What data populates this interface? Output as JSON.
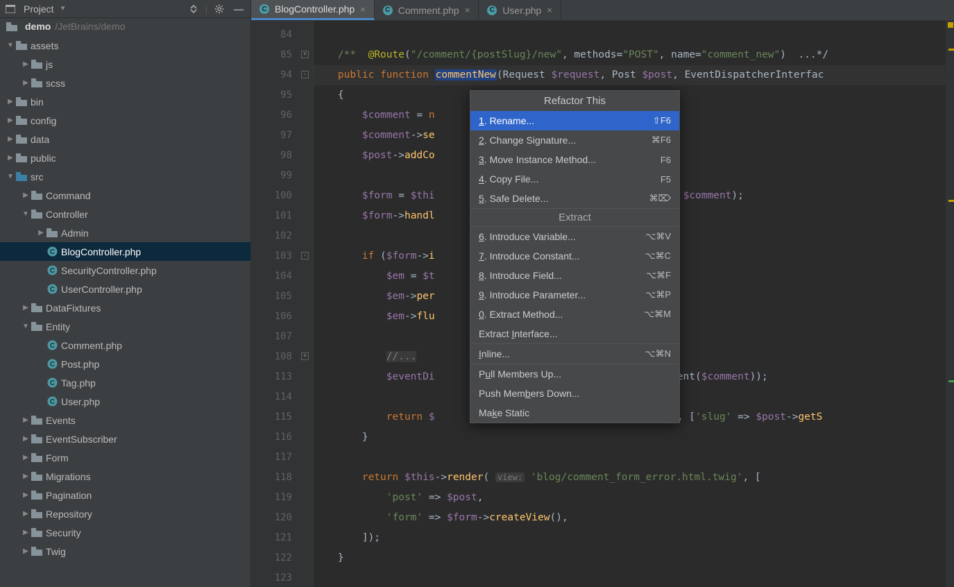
{
  "project_panel": {
    "title": "Project",
    "root_name": "demo",
    "root_path": "/JetBrains/demo",
    "tree": [
      {
        "depth": 0,
        "arrow": "exp",
        "kind": "folder",
        "label": "assets"
      },
      {
        "depth": 1,
        "arrow": "col",
        "kind": "folder",
        "label": "js"
      },
      {
        "depth": 1,
        "arrow": "col",
        "kind": "folder",
        "label": "scss"
      },
      {
        "depth": 0,
        "arrow": "col",
        "kind": "folder",
        "label": "bin"
      },
      {
        "depth": 0,
        "arrow": "col",
        "kind": "folder",
        "label": "config"
      },
      {
        "depth": 0,
        "arrow": "col",
        "kind": "folder",
        "label": "data"
      },
      {
        "depth": 0,
        "arrow": "col",
        "kind": "folder",
        "label": "public"
      },
      {
        "depth": 0,
        "arrow": "exp",
        "kind": "folder-src",
        "label": "src"
      },
      {
        "depth": 1,
        "arrow": "col",
        "kind": "folder",
        "label": "Command"
      },
      {
        "depth": 1,
        "arrow": "exp",
        "kind": "folder",
        "label": "Controller"
      },
      {
        "depth": 2,
        "arrow": "col",
        "kind": "folder",
        "label": "Admin"
      },
      {
        "depth": 2,
        "arrow": "none",
        "kind": "php",
        "label": "BlogController.php",
        "selected": true
      },
      {
        "depth": 2,
        "arrow": "none",
        "kind": "php",
        "label": "SecurityController.php"
      },
      {
        "depth": 2,
        "arrow": "none",
        "kind": "php",
        "label": "UserController.php"
      },
      {
        "depth": 1,
        "arrow": "col",
        "kind": "folder",
        "label": "DataFixtures"
      },
      {
        "depth": 1,
        "arrow": "exp",
        "kind": "folder",
        "label": "Entity"
      },
      {
        "depth": 2,
        "arrow": "none",
        "kind": "php",
        "label": "Comment.php"
      },
      {
        "depth": 2,
        "arrow": "none",
        "kind": "php",
        "label": "Post.php"
      },
      {
        "depth": 2,
        "arrow": "none",
        "kind": "php",
        "label": "Tag.php"
      },
      {
        "depth": 2,
        "arrow": "none",
        "kind": "php",
        "label": "User.php"
      },
      {
        "depth": 1,
        "arrow": "col",
        "kind": "folder",
        "label": "Events"
      },
      {
        "depth": 1,
        "arrow": "col",
        "kind": "folder",
        "label": "EventSubscriber"
      },
      {
        "depth": 1,
        "arrow": "col",
        "kind": "folder",
        "label": "Form"
      },
      {
        "depth": 1,
        "arrow": "col",
        "kind": "folder",
        "label": "Migrations"
      },
      {
        "depth": 1,
        "arrow": "col",
        "kind": "folder",
        "label": "Pagination"
      },
      {
        "depth": 1,
        "arrow": "col",
        "kind": "folder",
        "label": "Repository"
      },
      {
        "depth": 1,
        "arrow": "col",
        "kind": "folder",
        "label": "Security"
      },
      {
        "depth": 1,
        "arrow": "col",
        "kind": "folder",
        "label": "Twig"
      }
    ]
  },
  "tabs": [
    {
      "label": "BlogController.php",
      "active": true
    },
    {
      "label": "Comment.php",
      "active": false
    },
    {
      "label": "User.php",
      "active": false
    }
  ],
  "gutter_lines": [
    "84",
    "85",
    "94",
    "95",
    "96",
    "97",
    "98",
    "99",
    "100",
    "101",
    "102",
    "103",
    "104",
    "105",
    "106",
    "107",
    "108",
    "113",
    "114",
    "115",
    "116",
    "117",
    "118",
    "119",
    "120",
    "121",
    "122",
    "123"
  ],
  "gutter_fold": {
    "1": "+",
    "2": "-",
    "11": "-",
    "16": "+",
    "21": "",
    "22": ""
  },
  "code_lines": [
    {
      "html": ""
    },
    {
      "html": "    <span class='c-doc'>/**</span>  <span class='c-ann'>@Route</span><span class='c-text'>(</span><span class='c-str'>\"/comment/{postSlug}/new\"</span><span class='c-text'>, methods=</span><span class='c-str'>\"POST\"</span><span class='c-text'>, name=</span><span class='c-str'>\"comment_new\"</span><span class='c-text'>)  ...*/</span>"
    },
    {
      "hl": true,
      "html": "    <span class='c-kw'>public function</span> <span class='c-fnname'>commentNew</span><span class='c-text'>(Request </span><span class='c-var'>$request</span><span class='c-text'>, Post </span><span class='c-var'>$post</span><span class='c-text'>, EventDispatcherInterfac</span>"
    },
    {
      "html": "    <span class='c-text'>{</span>"
    },
    {
      "html": "        <span class='c-var'>$comment</span><span class='c-text'> = </span><span class='c-kw'>n</span>"
    },
    {
      "html": "        <span class='c-var'>$comment</span><span class='c-text'>-&gt;</span><span class='c-fn'>se</span>"
    },
    {
      "html": "        <span class='c-var'>$post</span><span class='c-text'>-&gt;</span><span class='c-fn'>addCo</span>"
    },
    {
      "html": ""
    },
    {
      "html": "        <span class='c-var'>$form</span><span class='c-text'> = </span><span class='c-var'>$thi</span><span style='visibility:hidden'>xxxxxxxxxxxxxxxxxxxxxxxxxxxxx</span><span class='c-text'>ype::</span><span class='c-var'>class</span><span class='c-text'>, </span><span class='c-var'>$comment</span><span class='c-text'>);</span>"
    },
    {
      "html": "        <span class='c-var'>$form</span><span class='c-text'>-&gt;</span><span class='c-fn'>handl</span>"
    },
    {
      "html": ""
    },
    {
      "html": "        <span class='c-kw'>if</span> <span class='c-text'>(</span><span class='c-var'>$form</span><span class='c-text'>-&gt;</span><span class='c-fn'>i</span><span style='visibility:hidden'>xxxxxxxxxxxxxxxxxxxxxxxxxxxxx</span><span class='c-fn'>id</span><span class='c-text'>()) {</span>"
    },
    {
      "html": "            <span class='c-var'>$em</span><span class='c-text'> = </span><span class='c-var'>$t</span><span style='visibility:hidden'>xxxxxxxxxxxxxxxxxxxxxxxxxxxxx</span><span class='c-fn'>er</span><span class='c-text'>();</span>"
    },
    {
      "html": "            <span class='c-var'>$em</span><span class='c-text'>-&gt;</span><span class='c-fn'>per</span>"
    },
    {
      "html": "            <span class='c-var'>$em</span><span class='c-text'>-&gt;</span><span class='c-fn'>flu</span>"
    },
    {
      "html": ""
    },
    {
      "html": "            <span class='c-cmt' style='background:#3a3a3a;'>//...</span>"
    },
    {
      "html": "            <span class='c-var'>$eventDi</span><span style='visibility:hidden'>xxxxxxxxxxxxxxxxxxxxxxxxxxxxx</span><span class='c-text'>ntCreatedEvent(</span><span class='c-var'>$comment</span><span class='c-text'>));</span>"
    },
    {
      "html": ""
    },
    {
      "html": "            <span class='c-kw'>return</span> <span class='c-var'>$</span><span style='visibility:hidden'>xxxxxxxxxxxxxxxxxxxxxxxxxxxxx</span><span class='c-str'>'blog_post'</span><span class='c-text'>, [</span><span class='c-str'>'slug'</span><span class='c-text'> =&gt; </span><span class='c-var'>$post</span><span class='c-text'>-&gt;</span><span class='c-fn'>getS</span>"
    },
    {
      "html": "        <span class='c-text'>}</span>"
    },
    {
      "html": ""
    },
    {
      "html": "        <span class='c-kw'>return</span> <span class='c-var'>$this</span><span class='c-text'>-&gt;</span><span class='c-fn'>render</span><span class='c-text'>( </span><span class='c-hint'>view:</span><span class='c-text'> </span><span class='c-str'>'blog/comment_form_error.html.twig'</span><span class='c-text'>, [</span>"
    },
    {
      "html": "            <span class='c-str'>'post'</span><span class='c-text'> =&gt; </span><span class='c-var'>$post</span><span class='c-text'>,</span>"
    },
    {
      "html": "            <span class='c-str'>'form'</span><span class='c-text'> =&gt; </span><span class='c-var'>$form</span><span class='c-text'>-&gt;</span><span class='c-fn'>createView</span><span class='c-text'>(),</span>"
    },
    {
      "html": "        <span class='c-text'>]);</span>"
    },
    {
      "html": "    <span class='c-text'>}</span>"
    },
    {
      "html": ""
    }
  ],
  "popup": {
    "title": "Refactor This",
    "section": "Extract",
    "groups": [
      [
        {
          "label": "1. Rename...",
          "shortcut": "⇧F6",
          "selected": true,
          "underline": 0
        },
        {
          "label": "2. Change Signature...",
          "shortcut": "⌘F6",
          "underline": 0
        },
        {
          "label": "3. Move Instance Method...",
          "shortcut": "F6",
          "underline": 0
        },
        {
          "label": "4. Copy File...",
          "shortcut": "F5",
          "underline": 0
        },
        {
          "label": "5. Safe Delete...",
          "shortcut": "⌘⌦",
          "underline": 0
        }
      ],
      [
        {
          "label": "6. Introduce Variable...",
          "shortcut": "⌥⌘V",
          "underline": 0
        },
        {
          "label": "7. Introduce Constant...",
          "shortcut": "⌥⌘C",
          "underline": 0
        },
        {
          "label": "8. Introduce Field...",
          "shortcut": "⌥⌘F",
          "underline": 0
        },
        {
          "label": "9. Introduce Parameter...",
          "shortcut": "⌥⌘P",
          "underline": 0
        },
        {
          "label": "0. Extract Method...",
          "shortcut": "⌥⌘M",
          "underline": 0
        },
        {
          "label": "Extract Interface...",
          "shortcut": "",
          "underline": 8
        }
      ],
      [
        {
          "label": "Inline...",
          "shortcut": "⌥⌘N",
          "underline": 0
        }
      ],
      [
        {
          "label": "Pull Members Up...",
          "shortcut": "",
          "underline": 1
        },
        {
          "label": "Push Members Down...",
          "shortcut": "",
          "underline": 8
        },
        {
          "label": "Make Static",
          "shortcut": "",
          "underline": 2
        }
      ]
    ]
  }
}
